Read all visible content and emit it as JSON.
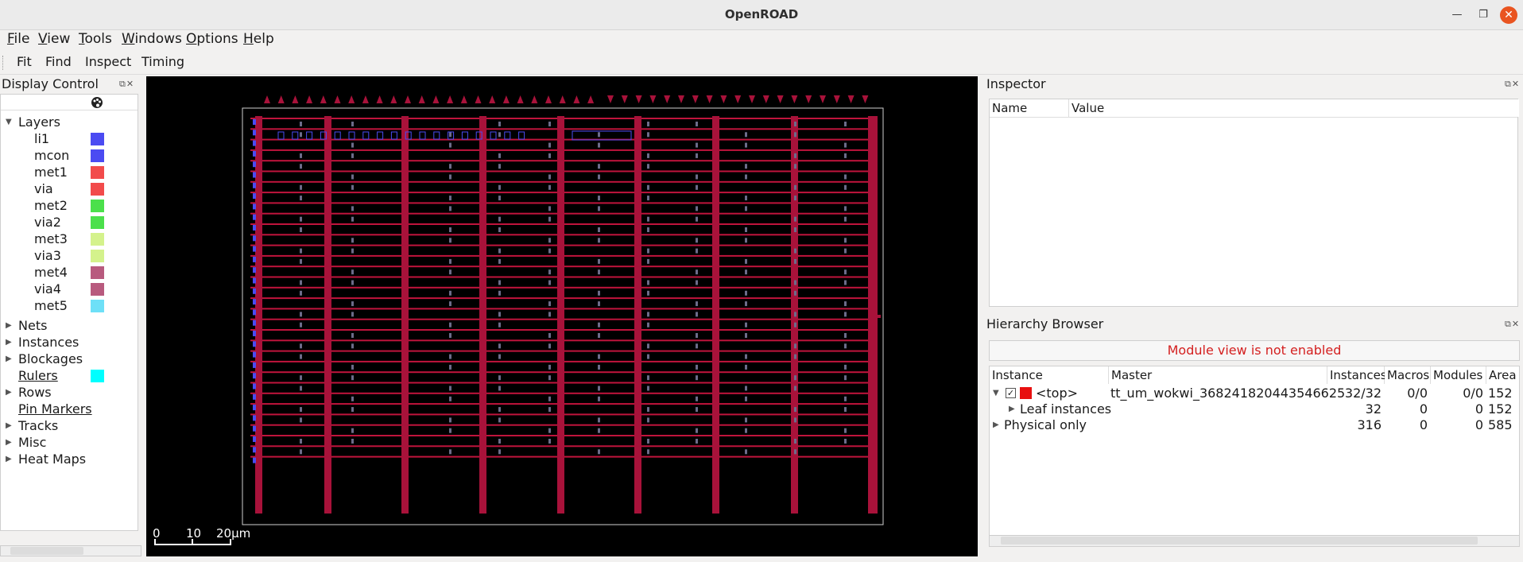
{
  "window": {
    "title": "OpenROAD"
  },
  "menu": [
    "File",
    "View",
    "Tools",
    "Windows",
    "Options",
    "Help"
  ],
  "toolbar": [
    "Fit",
    "Find",
    "Inspect",
    "Timing"
  ],
  "display_control": {
    "title": "Display Control",
    "layers_label": "Layers",
    "layers": [
      {
        "name": "li1",
        "color": "#4b4bf2"
      },
      {
        "name": "mcon",
        "color": "#4b4bf2"
      },
      {
        "name": "met1",
        "color": "#f24b4b"
      },
      {
        "name": "via",
        "color": "#f24b4b"
      },
      {
        "name": "met2",
        "color": "#4be04b"
      },
      {
        "name": "via2",
        "color": "#4be04b"
      },
      {
        "name": "met3",
        "color": "#d4f28c"
      },
      {
        "name": "via3",
        "color": "#d4f28c"
      },
      {
        "name": "met4",
        "color": "#b85a7e"
      },
      {
        "name": "via4",
        "color": "#b85a7e"
      },
      {
        "name": "met5",
        "color": "#6ee0f7"
      }
    ],
    "groups": [
      {
        "name": "Nets",
        "expandable": true
      },
      {
        "name": "Instances",
        "expandable": true
      },
      {
        "name": "Blockages",
        "expandable": true
      },
      {
        "name": "Rulers",
        "expandable": false,
        "underline": true,
        "color": "#00ffff"
      },
      {
        "name": "Rows",
        "expandable": true
      },
      {
        "name": "Pin Markers",
        "expandable": false,
        "underline": true
      },
      {
        "name": "Tracks",
        "expandable": true
      },
      {
        "name": "Misc",
        "expandable": true
      },
      {
        "name": "Heat Maps",
        "expandable": true
      }
    ]
  },
  "scale_bar": {
    "labels": [
      "0",
      "10",
      "20μm"
    ]
  },
  "inspector": {
    "title": "Inspector",
    "columns": [
      "Name",
      "Value"
    ]
  },
  "hierarchy": {
    "title": "Hierarchy Browser",
    "message": "Module view is not enabled",
    "columns": [
      "Instance",
      "Master",
      "Instances",
      "Macros",
      "Modules",
      "Area"
    ],
    "rows": [
      {
        "instance": "<top>",
        "master": "tt_um_wokwi_368241820443546625",
        "instances": "32/32",
        "macros": "0/0",
        "modules": "0/0",
        "area": "152"
      },
      {
        "instance": "Leaf instances",
        "master": "",
        "instances": "32",
        "macros": "0",
        "modules": "0",
        "area": "152"
      },
      {
        "instance": "Physical only",
        "master": "",
        "instances": "316",
        "macros": "0",
        "modules": "0",
        "area": "585"
      }
    ]
  },
  "colors": {
    "met1": "#c0143c",
    "die_outline": "#cfcfcf",
    "error_text": "#d42020"
  }
}
